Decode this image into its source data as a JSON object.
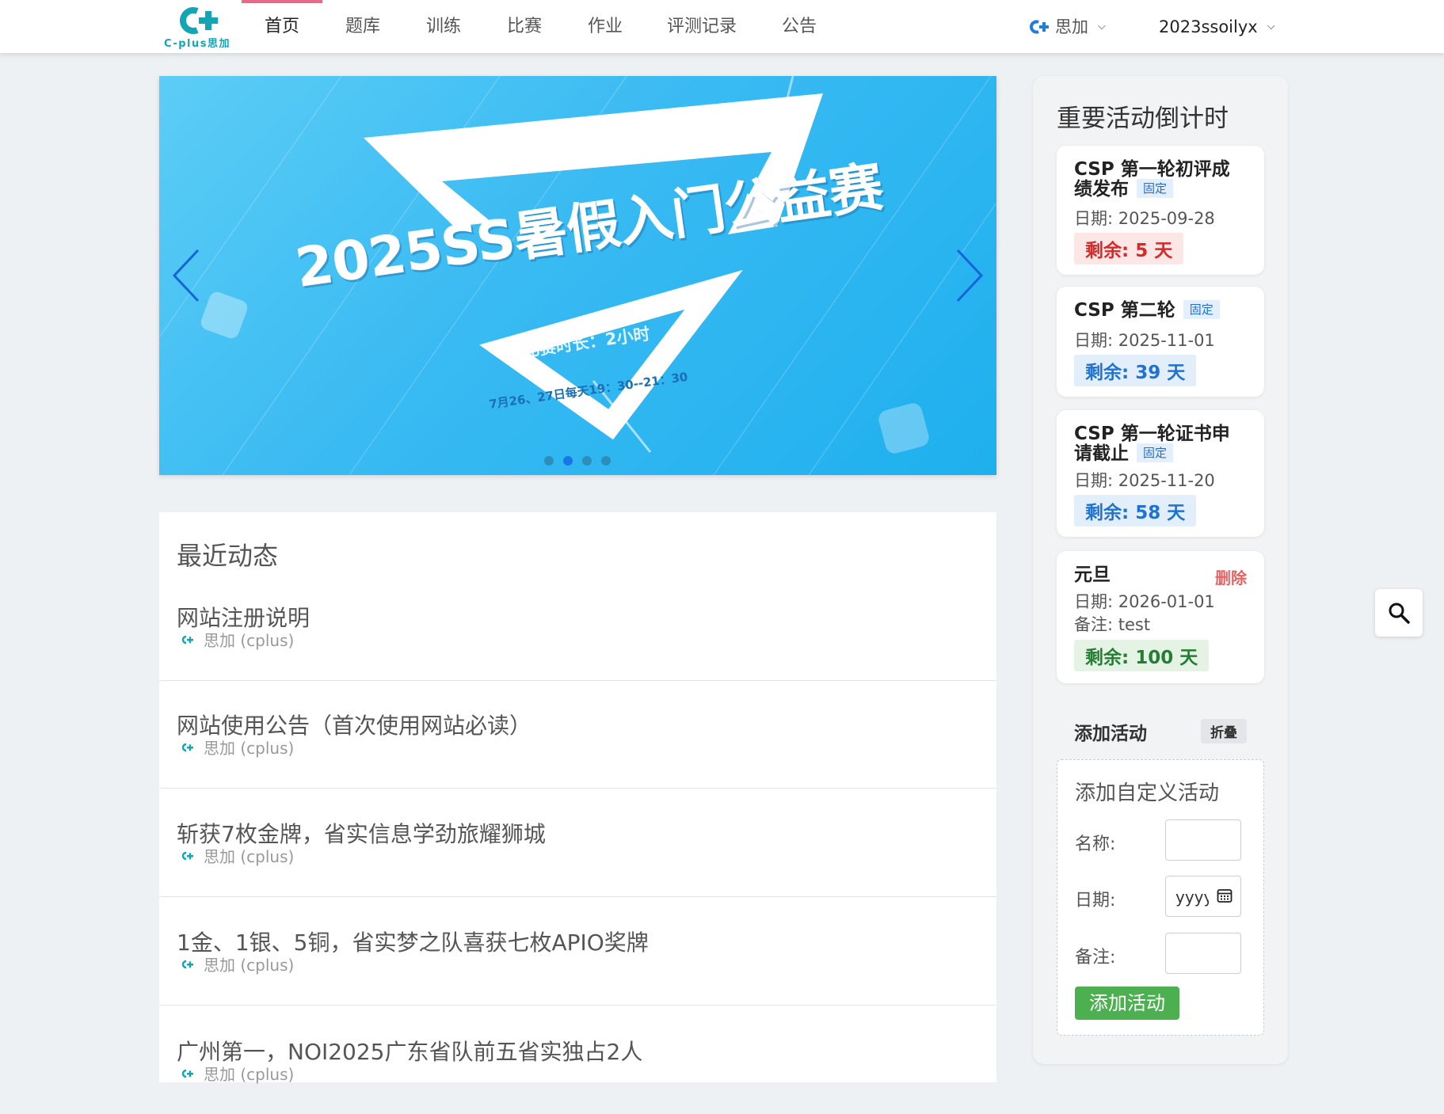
{
  "brand": {
    "logo_text": "C-plus思加",
    "accent": "#13a5b4"
  },
  "nav": {
    "items": [
      {
        "label": "首页",
        "active": true
      },
      {
        "label": "题库"
      },
      {
        "label": "训练"
      },
      {
        "label": "比赛",
        "bold": true
      },
      {
        "label": "作业"
      },
      {
        "label": "评测记录"
      },
      {
        "label": "公告"
      }
    ],
    "site_menu": "思加",
    "user_menu": "2023ssoilyx"
  },
  "carousel": {
    "title": "2025SS暑假入门公益赛",
    "subtitle": "比赛时长：2小时",
    "date_text": "7月26、27日每天19：30--21：30",
    "slides": 4,
    "active_slide": 2
  },
  "recent": {
    "title": "最近动态",
    "items": [
      {
        "title": "网站注册说明",
        "author": "思加 (cplus)"
      },
      {
        "title": "网站使用公告（首次使用网站必读）",
        "author": "思加 (cplus)"
      },
      {
        "title": "斩获7枚金牌，省实信息学劲旅耀狮城",
        "author": "思加 (cplus)"
      },
      {
        "title": "1金、1银、5铜，省实梦之队喜获七枚APIO奖牌",
        "author": "思加 (cplus)"
      },
      {
        "title": "广州第一，NOI2025广东省队前五省实独占2人",
        "author": "思加 (cplus)"
      }
    ]
  },
  "countdown": {
    "title": "重要活动倒计时",
    "events": [
      {
        "name": "CSP 第一轮初评成绩发布",
        "tag": "固定",
        "date": "日期: 2025-09-28",
        "remain": "剩余: 5 天"
      },
      {
        "name": "CSP 第二轮",
        "tag": "固定",
        "date": "日期: 2025-11-01",
        "remain": "剩余: 39 天"
      },
      {
        "name": "CSP 第一轮证书申请截止",
        "tag": "固定",
        "date": "日期: 2025-11-20",
        "remain": "剩余: 58 天"
      },
      {
        "name": "元旦",
        "delete": "删除",
        "date": "日期: 2026-01-01",
        "note": "备注: test",
        "remain": "剩余: 100 天"
      }
    ],
    "add": {
      "header": "添加活动",
      "fold": "折叠",
      "form_title": "添加自定义活动",
      "name_label": "名称:",
      "date_label": "日期:",
      "date_value": "yyyy",
      "note_label": "备注:",
      "submit": "添加活动"
    }
  }
}
